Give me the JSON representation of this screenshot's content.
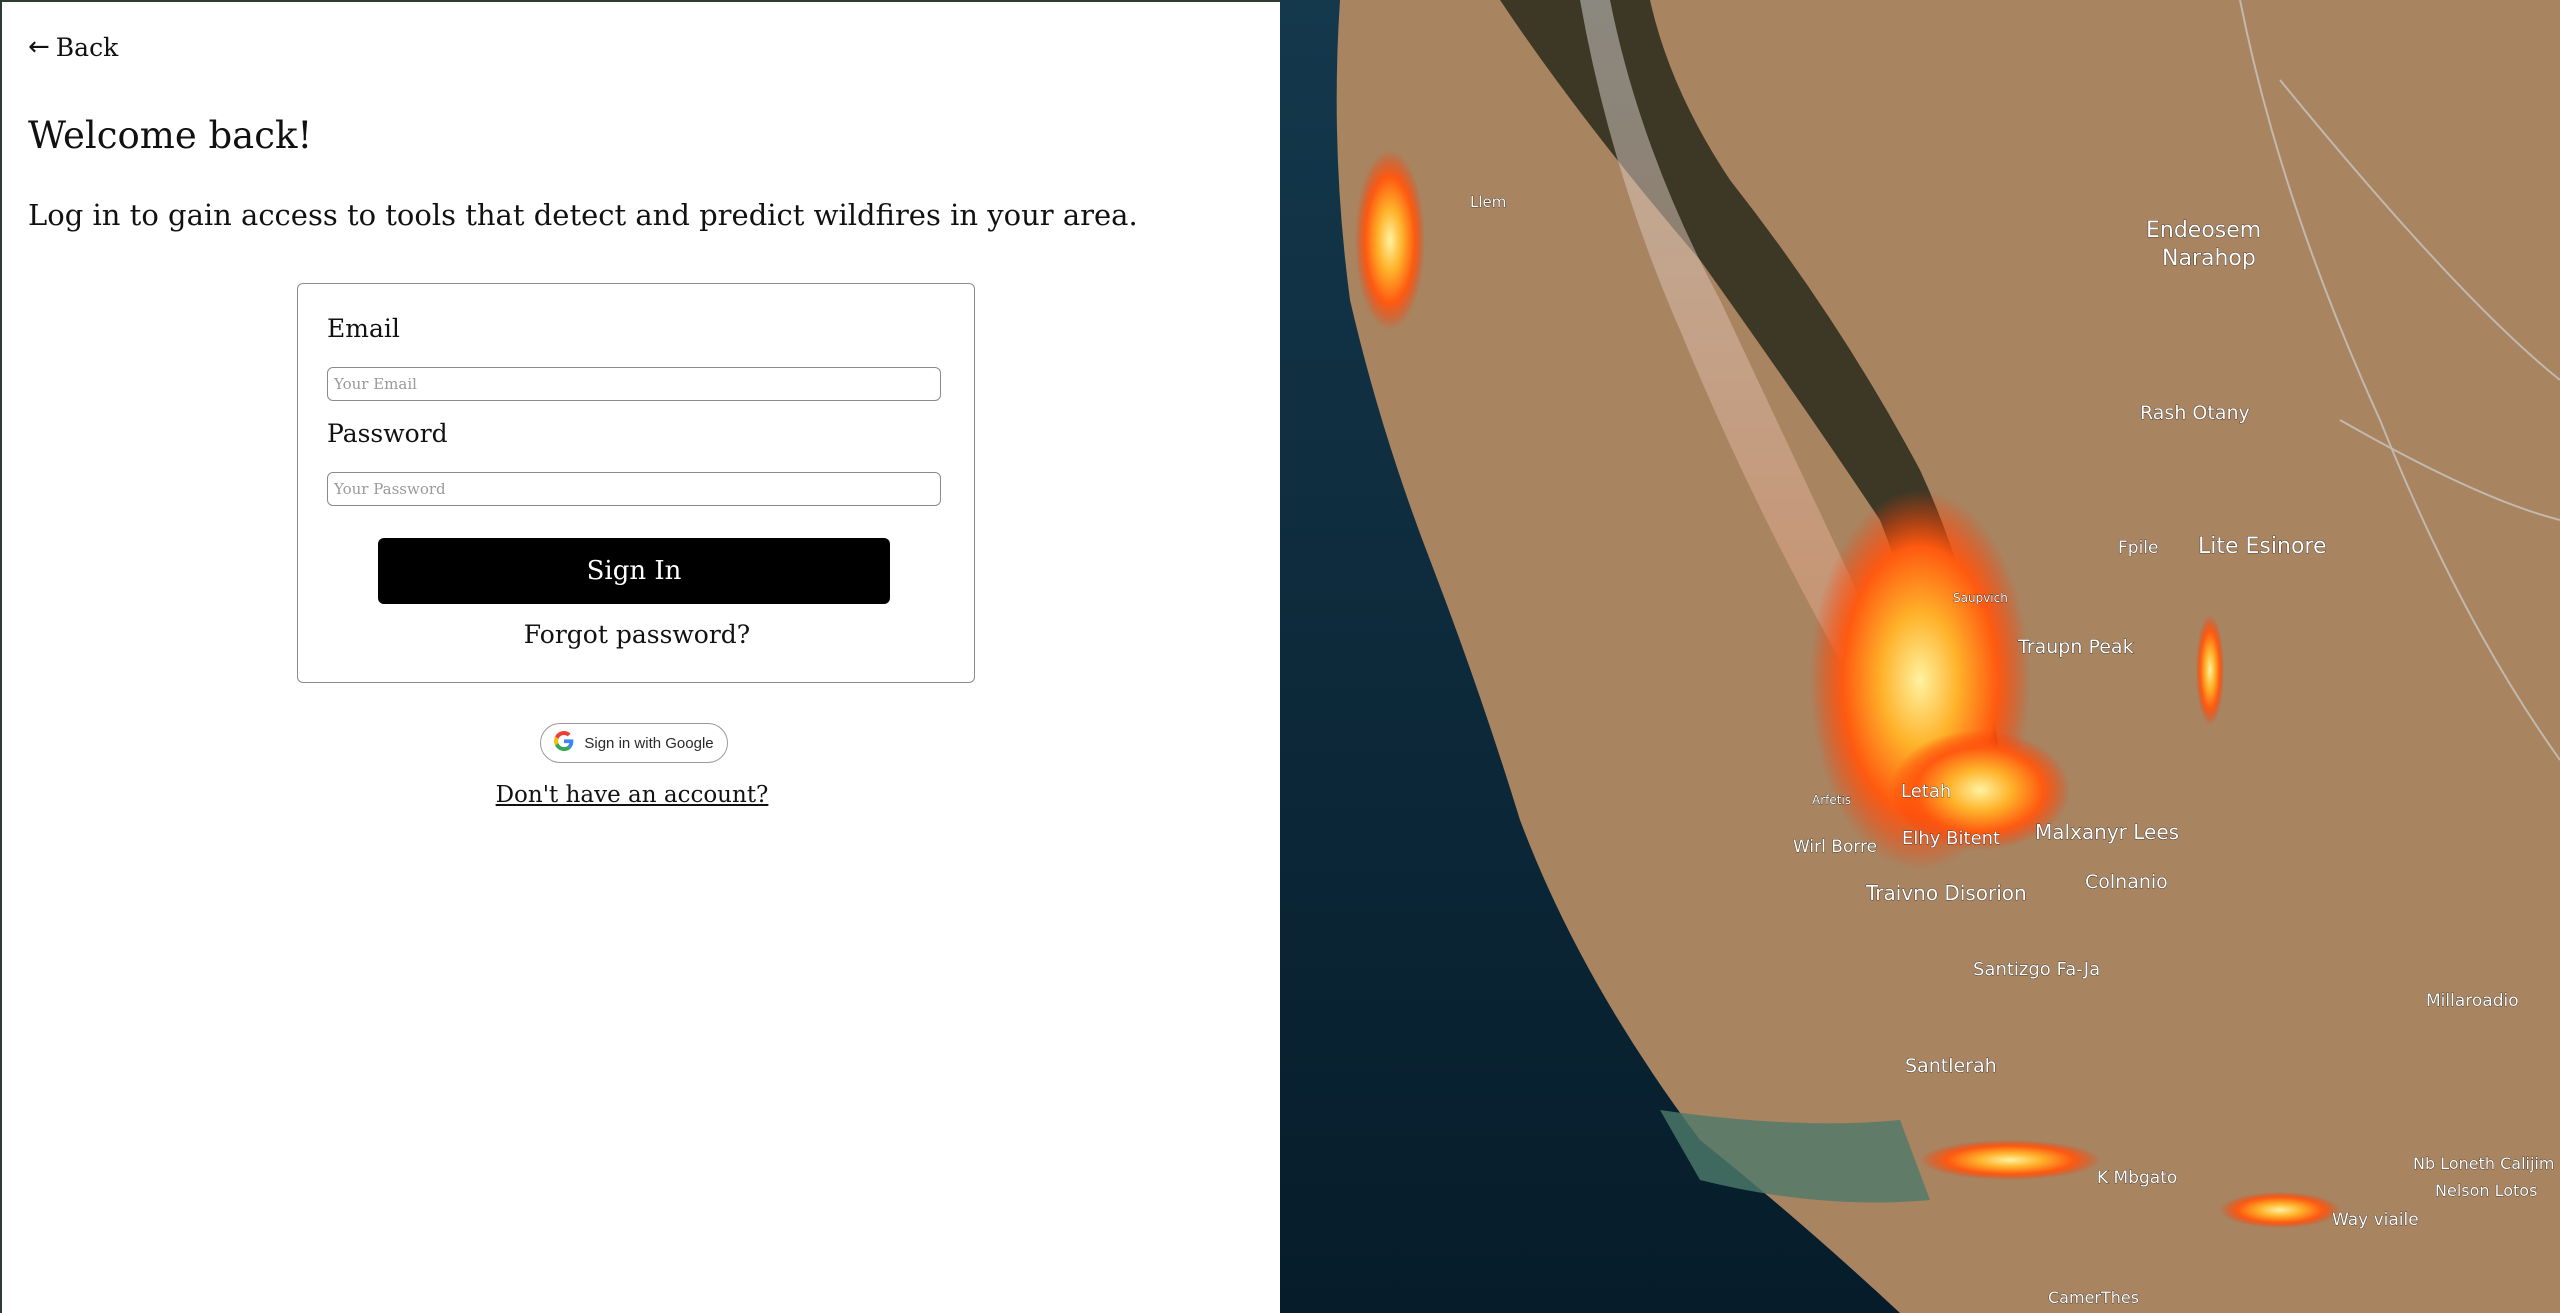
{
  "nav": {
    "back_label": "Back"
  },
  "header": {
    "title": "Welcome back!",
    "subtitle": "Log in to gain access to tools that detect and predict wildfires in your area."
  },
  "login_form": {
    "email_label": "Email",
    "email_placeholder": "Your Email",
    "password_label": "Password",
    "password_placeholder": "Your Password",
    "submit_label": "Sign In",
    "forgot_label": "Forgot password?"
  },
  "alt_auth": {
    "google_label": "Sign in with Google",
    "signup_label": "Don't have an account?"
  },
  "hero_map": {
    "labels": [
      "Llem",
      "Endeosem",
      "Narahop",
      "Rash Otany",
      "Fpile",
      "Lite Esinore",
      "Saupvich",
      "Traupn Peak",
      "Letah",
      "Arfetis",
      "Elhy Bitent",
      "Wirl Borre",
      "Malxanyr Lees",
      "Colnanio",
      "Traivno Disorion",
      "Santizgo Fa-Ja",
      "Millaroadio",
      "Santlerah",
      "K Mbgato",
      "Nb Loneth Calijim",
      "Nelson Lotos",
      "Way viaile",
      "CamerThes"
    ]
  },
  "colors": {
    "primary_button": "#000000",
    "text": "#111111",
    "ocean": "#0c2a3a",
    "land": "#a88460",
    "fire": "#ff7a1a"
  }
}
